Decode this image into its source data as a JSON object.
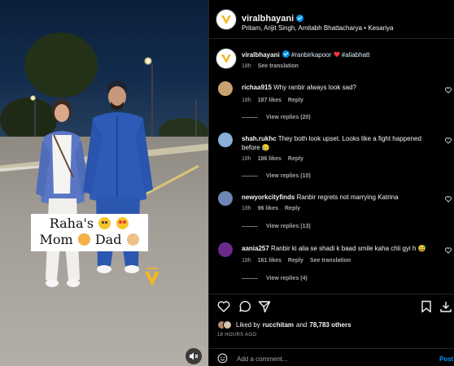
{
  "post": {
    "account": "viralbhayani",
    "audio": "Pritam, Arijit Singh, Amitabh Bhattacharya • Kesariya"
  },
  "media": {
    "caption_line1": "Raha's",
    "caption_line2_a": "Mom",
    "caption_line2_b": "Dad",
    "watermark_icon": "viral-bhayani-logo",
    "mute_icon": "speaker-muted-icon"
  },
  "caption": {
    "username": "viralbhayani",
    "text_a": "#ranbirkapoor",
    "text_b": "#aliabhatt",
    "age": "18h",
    "translation": "See translation"
  },
  "comments": [
    {
      "username": "richaa915",
      "text": "Why ranbir always look sad?",
      "age": "18h",
      "likes": "187 likes",
      "reply": "Reply",
      "view_replies": "View replies (20)",
      "avatar_color": "#c9a070"
    },
    {
      "username": "shah.rukhc",
      "text": "They both look upset. Looks like a fight happened before 😥",
      "age": "18h",
      "likes": "186 likes",
      "reply": "Reply",
      "view_replies": "View replies (10)",
      "avatar_color": "#8ab0d8"
    },
    {
      "username": "newyorkcityfinds",
      "text": "Ranbir regrets not marrying Katrina",
      "age": "18h",
      "likes": "96 likes",
      "reply": "Reply",
      "view_replies": "View replies (13)",
      "avatar_color": "#6e86b3"
    },
    {
      "username": "aania257",
      "text": "Ranbir ki alia se shadi k baad smile kaha chli gyi h 😅",
      "age": "18h",
      "likes": "161 likes",
      "reply": "Reply",
      "translation": "See translation",
      "view_replies": "View replies (4)",
      "avatar_color": "#6a2a8a"
    }
  ],
  "likes_row": {
    "prefix": "Liked by",
    "user": "rucchitam",
    "middle": "and",
    "count": "78,783 others"
  },
  "date": "18 HOURS AGO",
  "composer": {
    "placeholder": "Add a comment...",
    "post": "Post"
  },
  "colors": {
    "accent": "#0095f6",
    "like_red": "#ff3040",
    "muted_text": "#a8a8a8",
    "divider": "#262626"
  }
}
